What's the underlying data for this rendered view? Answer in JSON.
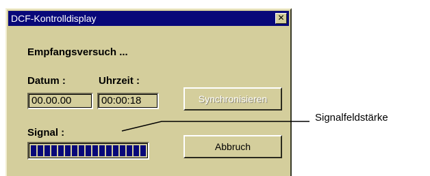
{
  "window": {
    "title": "DCF-Kontrolldisplay",
    "close_glyph": "✕"
  },
  "status": {
    "text": "Empfangsversuch ..."
  },
  "date": {
    "label": "Datum :",
    "value": "00.00.00"
  },
  "time": {
    "label": "Uhrzeit :",
    "value": "00:00:18"
  },
  "signal": {
    "label": "Signal :",
    "level_fraction": 1.0
  },
  "buttons": {
    "sync_label": "Synchronisieren",
    "sync_enabled": false,
    "cancel_label": "Abbruch"
  },
  "annotation": {
    "label": "Signalfeldstärke"
  },
  "colors": {
    "dialog_background": "#d4ce9c",
    "titlebar": "#080879",
    "progress_blocks": "#080879"
  }
}
